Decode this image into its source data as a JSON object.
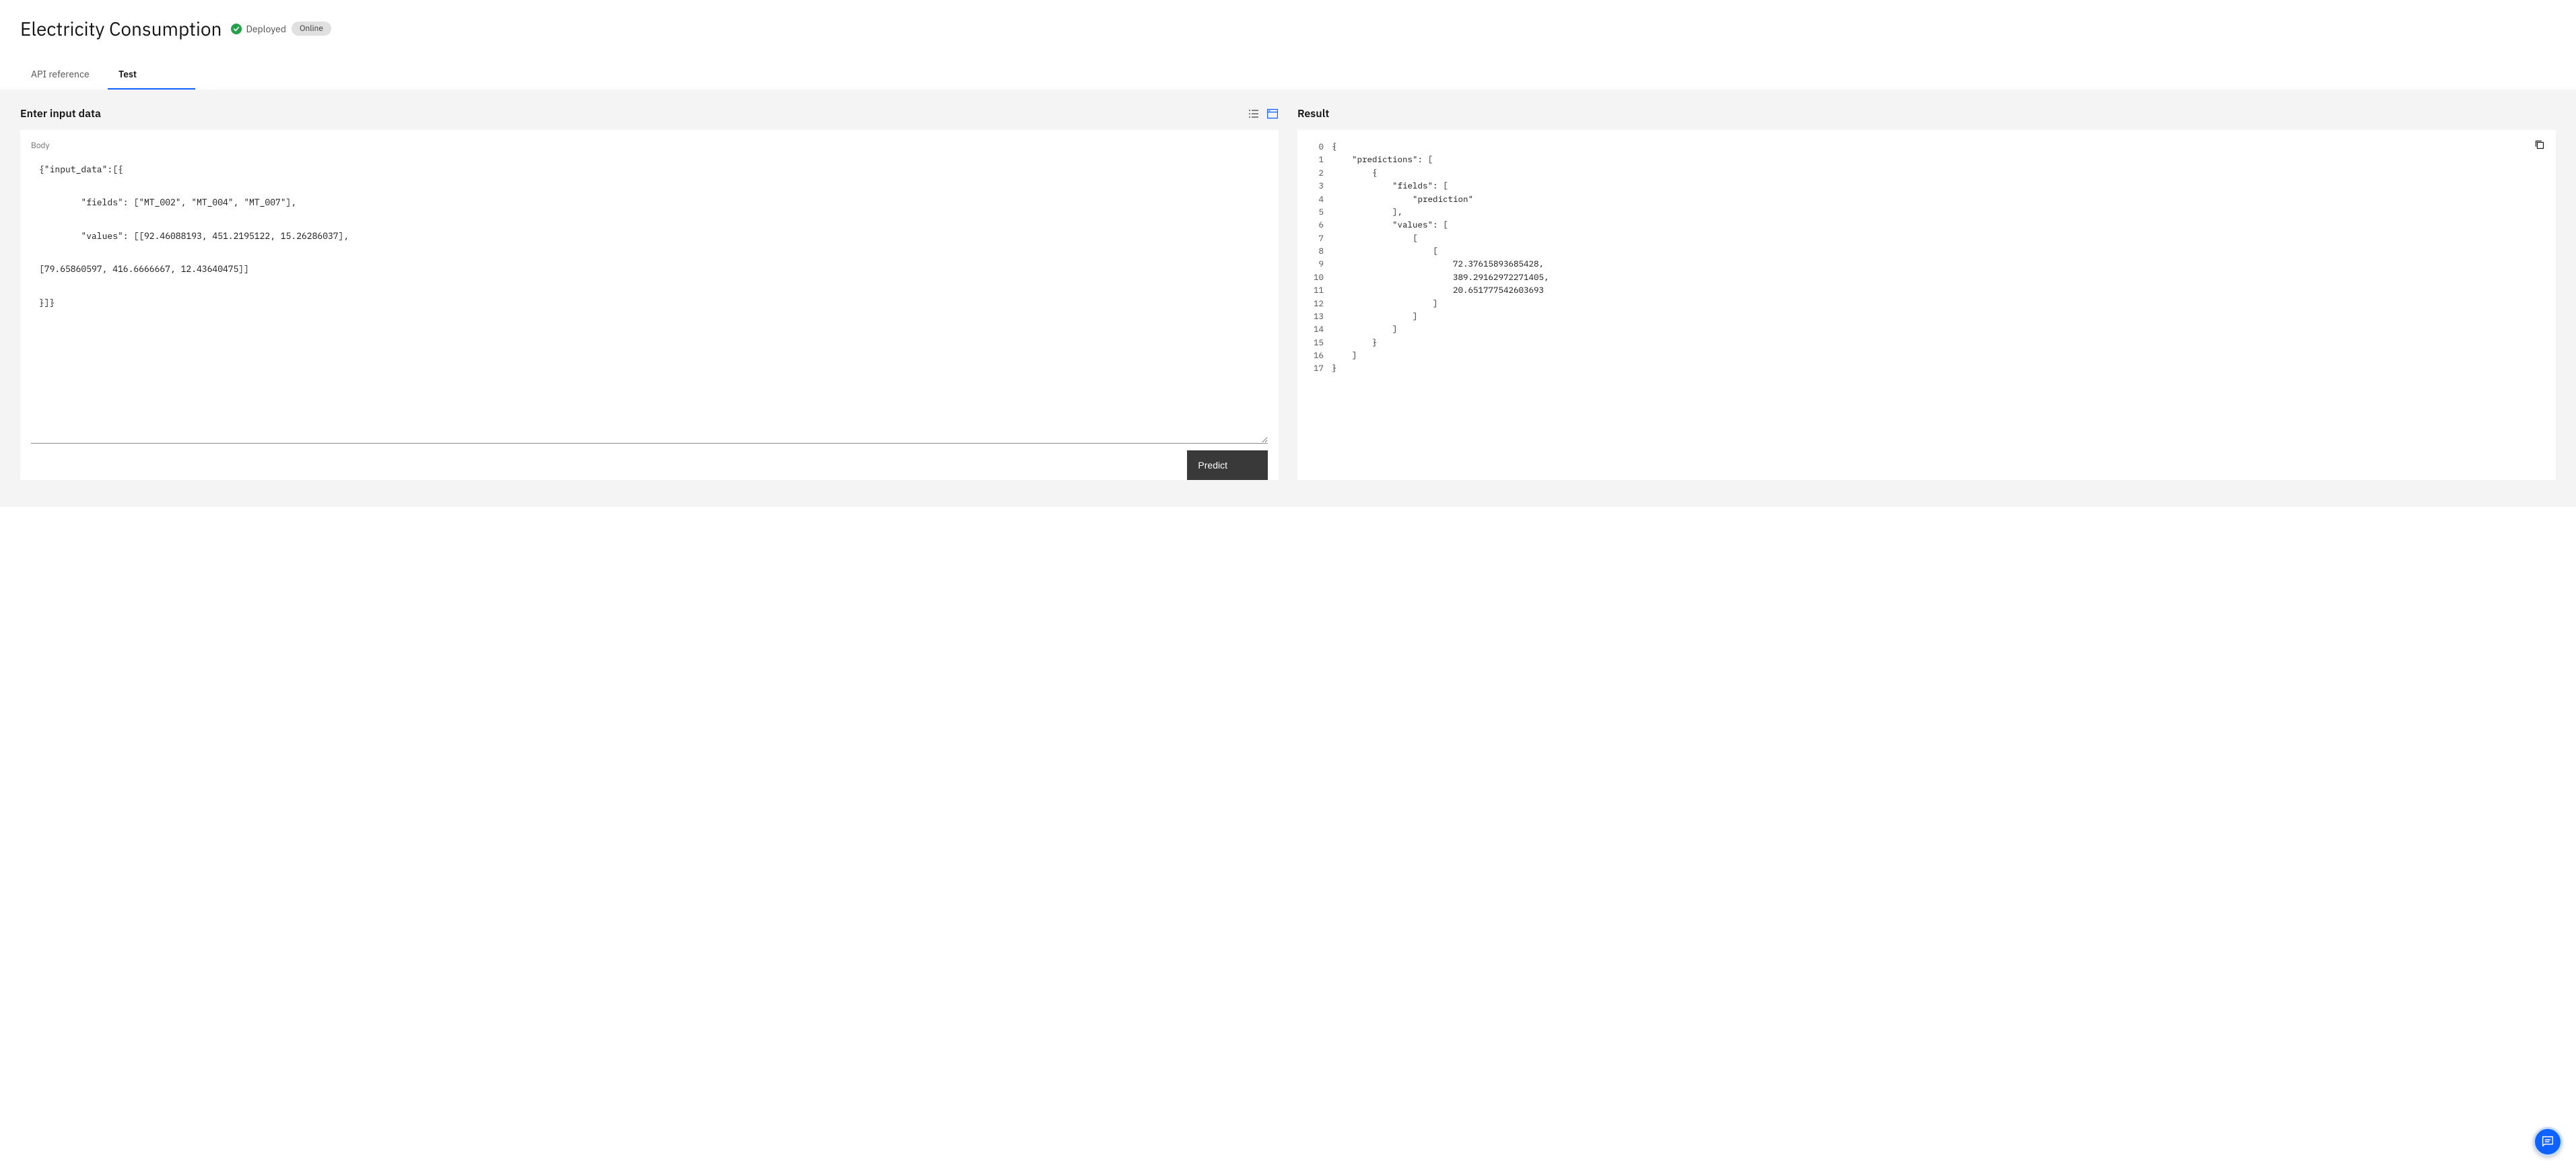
{
  "header": {
    "title": "Electricity Consumption",
    "deployed_label": "Deployed",
    "online_badge": "Online"
  },
  "tabs": {
    "api_reference": "API reference",
    "test": "Test"
  },
  "input_panel": {
    "heading": "Enter input data",
    "body_label": "Body",
    "body_value": "{\"input_data\":[{\n\n        \"fields\": [\"MT_002\", \"MT_004\", \"MT_007\"],\n\n        \"values\": [[92.46088193, 451.2195122, 15.26286037],\n\n[79.65860597, 416.6666667, 12.43640475]]\n\n}]}",
    "predict_button": "Predict"
  },
  "result_panel": {
    "heading": "Result",
    "line_numbers": " 0\n 1\n 2\n 3\n 4\n 5\n 6\n 7\n 8\n 9\n10\n11\n12\n13\n14\n15\n16\n17",
    "code": "{\n    \"predictions\": [\n        {\n            \"fields\": [\n                \"prediction\"\n            ],\n            \"values\": [\n                [\n                    [\n                        72.37615893685428,\n                        389.29162972271405,\n                        20.651777542603693\n                    ]\n                ]\n            ]\n        }\n    ]\n}"
  }
}
